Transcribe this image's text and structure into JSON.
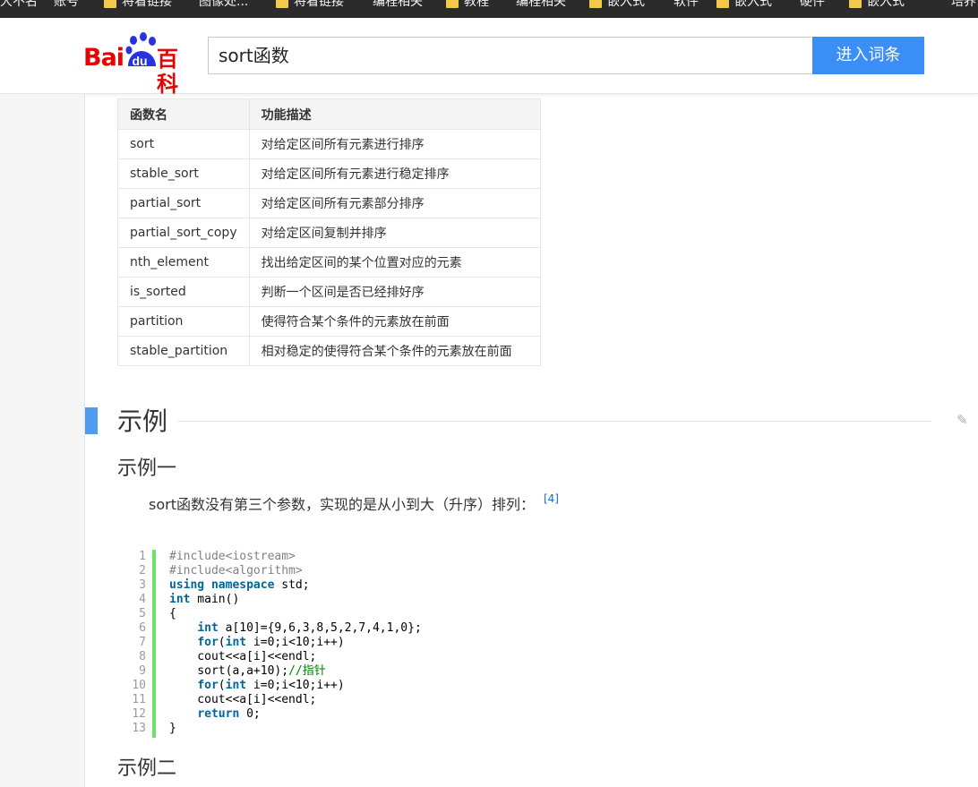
{
  "bookmarks": [
    {
      "label": "大不名"
    },
    {
      "label": "账号"
    },
    {
      "label": "将看链接"
    },
    {
      "label": "图像处..."
    },
    {
      "label": "将看链接"
    },
    {
      "label": "编程相关"
    },
    {
      "label": "教程"
    },
    {
      "label": "编程相关"
    },
    {
      "label": "嵌入式"
    },
    {
      "label": "软件"
    },
    {
      "label": "嵌入式"
    },
    {
      "label": "硬件"
    },
    {
      "label": "嵌入式"
    },
    {
      "label": "培养自己开放"
    }
  ],
  "header": {
    "logo_bai": "Bai",
    "logo_du": "du",
    "logo_baike": "百科",
    "search_value": "sort函数",
    "enter_button": "进入词条"
  },
  "table": {
    "headers": [
      "函数名",
      "功能描述"
    ],
    "rows": [
      [
        "sort",
        "对给定区间所有元素进行排序"
      ],
      [
        "stable_sort",
        "对给定区间所有元素进行稳定排序"
      ],
      [
        "partial_sort",
        "对给定区间所有元素部分排序"
      ],
      [
        "partial_sort_copy",
        "对给定区间复制并排序"
      ],
      [
        "nth_element",
        "找出给定区间的某个位置对应的元素"
      ],
      [
        "is_sorted",
        "判断一个区间是否已经排好序"
      ],
      [
        "partition",
        "使得符合某个条件的元素放在前面"
      ],
      [
        "stable_partition",
        "相对稳定的使得符合某个条件的元素放在前面"
      ]
    ]
  },
  "section": {
    "title": "示例",
    "example1_title": "示例一",
    "example1_desc": "sort函数没有第三个参数，实现的是从小到大（升序）排列：",
    "example1_ref": "[4]",
    "example2_title": "示例二"
  },
  "code": {
    "line_numbers": [
      "1",
      "2",
      "3",
      "4",
      "5",
      "6",
      "7",
      "8",
      "9",
      "10",
      "11",
      "12",
      "13"
    ],
    "lines": [
      "#include<iostream>",
      "#include<algorithm>",
      "using namespace std;",
      "int main()",
      "{",
      "    int a[10]={9,6,3,8,5,2,7,4,1,0};",
      "    for(int i=0;i<10;i++)",
      "    cout<<a[i]<<endl;",
      "    sort(a,a+10);//指针",
      "    for(int i=0;i<10;i++)",
      "    cout<<a[i]<<endl;",
      "    return 0;",
      "}"
    ]
  },
  "colors": {
    "accent_blue": "#3a8ef6",
    "section_bar": "#4f9cee",
    "logo_red": "#e10602",
    "code_bar_green": "#6ce26c"
  }
}
